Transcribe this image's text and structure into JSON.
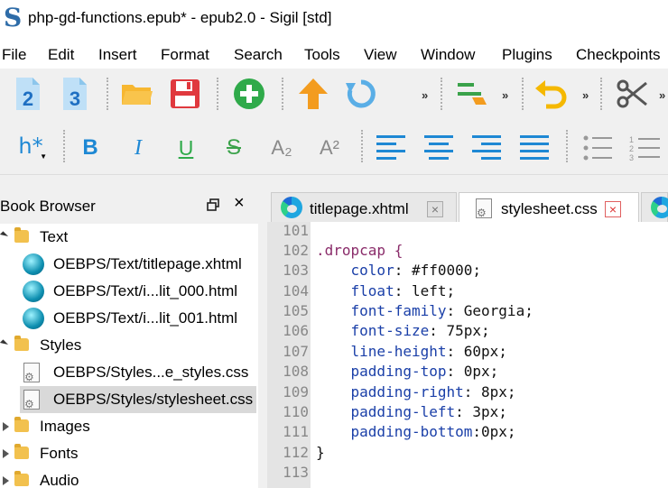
{
  "window": {
    "title": "php-gd-functions.epub* - epub2.0 - Sigil [std]"
  },
  "menu": [
    "File",
    "Edit",
    "Insert",
    "Format",
    "Search",
    "Tools",
    "View",
    "Window",
    "Plugins",
    "Checkpoints"
  ],
  "toolbar1": {
    "heading2_label": "2",
    "heading3_label": "3",
    "overflow": "»"
  },
  "toolbar2": {
    "heading_label": "h*",
    "bold_label": "B",
    "italic_label": "I",
    "underline_label": "U",
    "strike_label": "S",
    "subscript_label": "A₂",
    "superscript_label": "A²"
  },
  "book_browser": {
    "title": "Book Browser",
    "close_label": "×",
    "items": [
      {
        "label": "Text",
        "kind": "folder",
        "state": "open"
      },
      {
        "label": "OEBPS/Text/titlepage.xhtml",
        "kind": "xhtml"
      },
      {
        "label": "OEBPS/Text/i...lit_000.html",
        "kind": "xhtml"
      },
      {
        "label": "OEBPS/Text/i...lit_001.html",
        "kind": "xhtml"
      },
      {
        "label": "Styles",
        "kind": "folder",
        "state": "open"
      },
      {
        "label": "OEBPS/Styles...e_styles.css",
        "kind": "css"
      },
      {
        "label": "OEBPS/Styles/stylesheet.css",
        "kind": "css",
        "selected": true
      },
      {
        "label": "Images",
        "kind": "folder",
        "state": "closed"
      },
      {
        "label": "Fonts",
        "kind": "folder",
        "state": "closed"
      },
      {
        "label": "Audio",
        "kind": "folder",
        "state": "closed"
      }
    ]
  },
  "tabs": [
    {
      "label": "titlepage.xhtml",
      "close": "×"
    },
    {
      "label": "stylesheet.css",
      "close": "×",
      "active": true
    }
  ],
  "editor": {
    "lines": [
      {
        "num": "101",
        "text": ""
      },
      {
        "num": "102",
        "text": ".dropcap {"
      },
      {
        "num": "103",
        "prop": "    color",
        "val": ": #ff0000;"
      },
      {
        "num": "104",
        "prop": "    float",
        "val": ": left;"
      },
      {
        "num": "105",
        "prop": "    font-family",
        "val": ": Georgia;"
      },
      {
        "num": "106",
        "prop": "    font-size",
        "val": ": 75px;"
      },
      {
        "num": "107",
        "prop": "    line-height",
        "val": ": 60px;"
      },
      {
        "num": "108",
        "prop": "    padding-top",
        "val": ": 0px;"
      },
      {
        "num": "109",
        "prop": "    padding-right",
        "val": ": 8px;"
      },
      {
        "num": "110",
        "prop": "    padding-left",
        "val": ": 3px;"
      },
      {
        "num": "111",
        "prop": "    padding-bottom",
        "val": ":0px;"
      },
      {
        "num": "112",
        "text": "}"
      },
      {
        "num": "113",
        "text": ""
      }
    ]
  },
  "colors": {
    "accent_blue": "#1e88d4",
    "save_red": "#e0393e",
    "add_green": "#2faa4a",
    "arrow_orange": "#f39c1f",
    "selector": "#8a2c6a",
    "property": "#1a3fa8"
  }
}
